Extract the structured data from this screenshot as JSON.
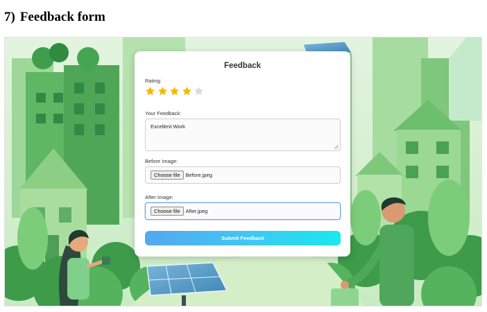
{
  "heading": {
    "number": "7)",
    "title": "Feedback form"
  },
  "background": {
    "description_icon": "green-city-illustration"
  },
  "form": {
    "title": "Feedback",
    "rating": {
      "label": "Rating:",
      "value": 4,
      "max": 5,
      "filled_color": "#f5b70a",
      "empty_color": "#dcdcdc"
    },
    "feedback": {
      "label": "Your Feedback:",
      "value": "Excellent Work"
    },
    "before_image": {
      "label": "Before Image:",
      "button_label": "Choose file",
      "filename": "Before.jpeg"
    },
    "after_image": {
      "label": "After Image:",
      "button_label": "Choose file",
      "filename": "After.jpeg"
    },
    "submit_label": "Submit Feedback",
    "submit_gradient": [
      "#54a8ee",
      "#19e8ee"
    ]
  }
}
